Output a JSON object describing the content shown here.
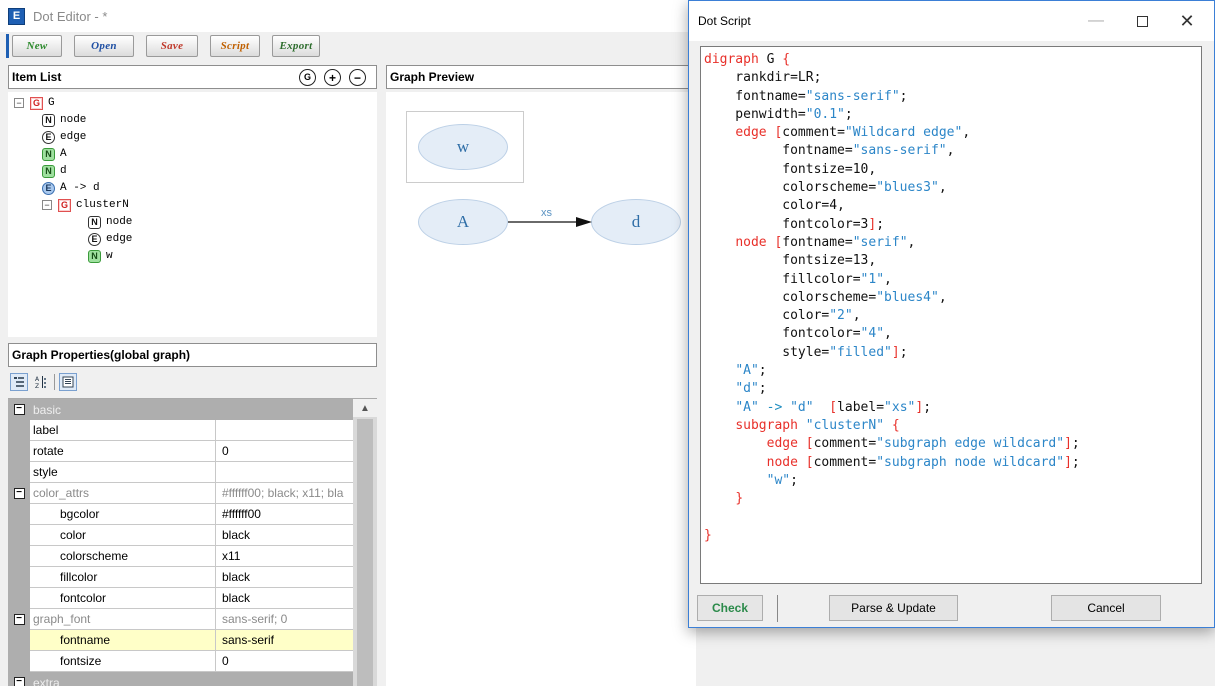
{
  "main_window": {
    "app_icon_letter": "E",
    "title": "Dot Editor - *"
  },
  "toolbar": {
    "new_label": "New",
    "open_label": "Open",
    "save_label": "Save",
    "script_label": "Script",
    "export_label": "Export"
  },
  "item_list": {
    "title": "Item List",
    "header_icons": [
      "G",
      "+",
      "−"
    ],
    "tree": [
      {
        "toggle": "−",
        "badge": "G",
        "label": "G"
      },
      {
        "badge": "N",
        "label": "node"
      },
      {
        "badge": "E",
        "label": "edge"
      },
      {
        "badge": "N",
        "label": "A"
      },
      {
        "badge": "N",
        "label": "d"
      },
      {
        "badge": "E",
        "label": "A -> d"
      },
      {
        "toggle": "−",
        "badge": "G",
        "label": "clusterN"
      },
      {
        "badge": "N",
        "label": "node"
      },
      {
        "badge": "E",
        "label": "edge"
      },
      {
        "badge": "N",
        "label": "w"
      }
    ]
  },
  "graph_properties": {
    "title": "Graph Properties(global graph)",
    "rows": [
      {
        "name": "basic",
        "value": "",
        "kind": "category"
      },
      {
        "name": "label",
        "value": ""
      },
      {
        "name": "rotate",
        "value": "0"
      },
      {
        "name": "style",
        "value": ""
      },
      {
        "name": "color_attrs",
        "value": "#ffffff00; black; x11; bla",
        "kind": "group"
      },
      {
        "name": "bgcolor",
        "value": "#ffffff00"
      },
      {
        "name": "color",
        "value": "black"
      },
      {
        "name": "colorscheme",
        "value": "x11"
      },
      {
        "name": "fillcolor",
        "value": "black"
      },
      {
        "name": "fontcolor",
        "value": "black"
      },
      {
        "name": "graph_font",
        "value": "sans-serif; 0",
        "kind": "group"
      },
      {
        "name": "fontname",
        "value": "sans-serif",
        "selected": true
      },
      {
        "name": "fontsize",
        "value": "0"
      },
      {
        "name": "extra",
        "value": "",
        "kind": "category"
      }
    ]
  },
  "graph_preview": {
    "title": "Graph Preview",
    "nodes": {
      "w": "w",
      "A": "A",
      "d": "d"
    },
    "edge_label": "xs"
  },
  "dot_script": {
    "title": "Dot Script",
    "buttons": {
      "check": "Check",
      "parse": "Parse & Update",
      "cancel": "Cancel"
    },
    "lines": [
      [
        [
          "kw",
          "digraph"
        ],
        [
          "p",
          " G "
        ],
        [
          "kw",
          "{"
        ]
      ],
      [
        [
          "p",
          "    rankdir=LR;"
        ]
      ],
      [
        [
          "p",
          "    fontname="
        ],
        [
          "st",
          "\"sans-serif\""
        ],
        [
          "p",
          ";"
        ]
      ],
      [
        [
          "p",
          "    penwidth="
        ],
        [
          "st",
          "\"0.1\""
        ],
        [
          "p",
          ";"
        ]
      ],
      [
        [
          "p",
          "    "
        ],
        [
          "kw",
          "edge ["
        ],
        [
          "p",
          "comment="
        ],
        [
          "st",
          "\"Wildcard edge\""
        ],
        [
          "p",
          ","
        ]
      ],
      [
        [
          "p",
          "          fontname="
        ],
        [
          "st",
          "\"sans-serif\""
        ],
        [
          "p",
          ","
        ]
      ],
      [
        [
          "p",
          "          fontsize=10,"
        ]
      ],
      [
        [
          "p",
          "          colorscheme="
        ],
        [
          "st",
          "\"blues3\""
        ],
        [
          "p",
          ","
        ]
      ],
      [
        [
          "p",
          "          color=4,"
        ]
      ],
      [
        [
          "p",
          "          fontcolor=3"
        ],
        [
          "kw",
          "]"
        ],
        [
          "p",
          ";"
        ]
      ],
      [
        [
          "p",
          "    "
        ],
        [
          "kw",
          "node ["
        ],
        [
          "p",
          "fontname="
        ],
        [
          "st",
          "\"serif\""
        ],
        [
          "p",
          ","
        ]
      ],
      [
        [
          "p",
          "          fontsize=13,"
        ]
      ],
      [
        [
          "p",
          "          fillcolor="
        ],
        [
          "st",
          "\"1\""
        ],
        [
          "p",
          ","
        ]
      ],
      [
        [
          "p",
          "          colorscheme="
        ],
        [
          "st",
          "\"blues4\""
        ],
        [
          "p",
          ","
        ]
      ],
      [
        [
          "p",
          "          color="
        ],
        [
          "st",
          "\"2\""
        ],
        [
          "p",
          ","
        ]
      ],
      [
        [
          "p",
          "          fontcolor="
        ],
        [
          "st",
          "\"4\""
        ],
        [
          "p",
          ","
        ]
      ],
      [
        [
          "p",
          "          style="
        ],
        [
          "st",
          "\"filled\""
        ],
        [
          "kw",
          "]"
        ],
        [
          "p",
          ";"
        ]
      ],
      [
        [
          "p",
          "    "
        ],
        [
          "st",
          "\"A\""
        ],
        [
          "p",
          ";"
        ]
      ],
      [
        [
          "p",
          "    "
        ],
        [
          "st",
          "\"d\""
        ],
        [
          "p",
          ";"
        ]
      ],
      [
        [
          "p",
          "    "
        ],
        [
          "st",
          "\"A\""
        ],
        [
          "ac",
          " -> "
        ],
        [
          "st",
          "\"d\""
        ],
        [
          "p",
          "  "
        ],
        [
          "kw",
          "["
        ],
        [
          "p",
          "label="
        ],
        [
          "st",
          "\"xs\""
        ],
        [
          "kw",
          "]"
        ],
        [
          "p",
          ";"
        ]
      ],
      [
        [
          "p",
          "    "
        ],
        [
          "kw",
          "subgraph"
        ],
        [
          "p",
          " "
        ],
        [
          "st",
          "\"clusterN\""
        ],
        [
          "p",
          " "
        ],
        [
          "kw",
          "{"
        ]
      ],
      [
        [
          "p",
          "        "
        ],
        [
          "kw",
          "edge ["
        ],
        [
          "p",
          "comment="
        ],
        [
          "st",
          "\"subgraph edge wildcard\""
        ],
        [
          "kw",
          "]"
        ],
        [
          "p",
          ";"
        ]
      ],
      [
        [
          "p",
          "        "
        ],
        [
          "kw",
          "node ["
        ],
        [
          "p",
          "comment="
        ],
        [
          "st",
          "\"subgraph node wildcard\""
        ],
        [
          "kw",
          "]"
        ],
        [
          "p",
          ";"
        ]
      ],
      [
        [
          "p",
          "        "
        ],
        [
          "st",
          "\"w\""
        ],
        [
          "p",
          ";"
        ]
      ],
      [
        [
          "p",
          "    "
        ],
        [
          "kw",
          "}"
        ]
      ],
      [
        [
          "p",
          ""
        ]
      ],
      [
        [
          "kw",
          "}"
        ]
      ]
    ]
  },
  "colors": {
    "accent": "#1e5fb3",
    "node_fill": "#e4edf7",
    "node_text": "#2f6ea7",
    "keyword": "#e8302a",
    "string": "#2c86c8",
    "check_text": "#2b8a4a",
    "selected_row": "#ffffc8"
  }
}
